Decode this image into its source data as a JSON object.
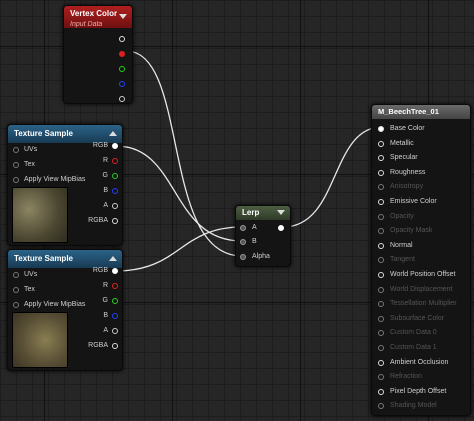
{
  "vertex_color": {
    "title": "Vertex Color",
    "subtitle": "Input Data"
  },
  "texture_sample_1": {
    "title": "Texture Sample",
    "inputs": [
      "UVs",
      "Tex",
      "Apply View MipBias"
    ],
    "outputs": [
      "RGB",
      "R",
      "G",
      "B",
      "A",
      "RGBA"
    ]
  },
  "texture_sample_2": {
    "title": "Texture Sample",
    "inputs": [
      "UVs",
      "Tex",
      "Apply View MipBias"
    ],
    "outputs": [
      "RGB",
      "R",
      "G",
      "B",
      "A",
      "RGBA"
    ]
  },
  "lerp": {
    "title": "Lerp",
    "inputs": [
      "A",
      "B",
      "Alpha"
    ]
  },
  "material": {
    "title": "M_BeechTree_01",
    "inputs": [
      {
        "label": "Base Color",
        "active": true
      },
      {
        "label": "Metallic",
        "active": true
      },
      {
        "label": "Specular",
        "active": true
      },
      {
        "label": "Roughness",
        "active": true
      },
      {
        "label": "Anisotropy",
        "active": false
      },
      {
        "label": "Emissive Color",
        "active": true
      },
      {
        "label": "Opacity",
        "active": false
      },
      {
        "label": "Opacity Mask",
        "active": false
      },
      {
        "label": "Normal",
        "active": true
      },
      {
        "label": "Tangent",
        "active": false
      },
      {
        "label": "World Position Offset",
        "active": true
      },
      {
        "label": "World Displacement",
        "active": false
      },
      {
        "label": "Tessellation Multiplier",
        "active": false
      },
      {
        "label": "Subsurface Color",
        "active": false
      },
      {
        "label": "Custom Data 0",
        "active": false
      },
      {
        "label": "Custom Data 1",
        "active": false
      },
      {
        "label": "Ambient Occlusion",
        "active": true
      },
      {
        "label": "Refraction",
        "active": false
      },
      {
        "label": "Pixel Depth Offset",
        "active": true
      },
      {
        "label": "Shading Model",
        "active": false
      }
    ]
  },
  "colors": {
    "vertex_header": "#8a1414",
    "texture_header": "#1f4a66",
    "lerp_header": "#3e4b35",
    "material_header": "#5a5a5a",
    "wire": "#e8e8e8"
  }
}
